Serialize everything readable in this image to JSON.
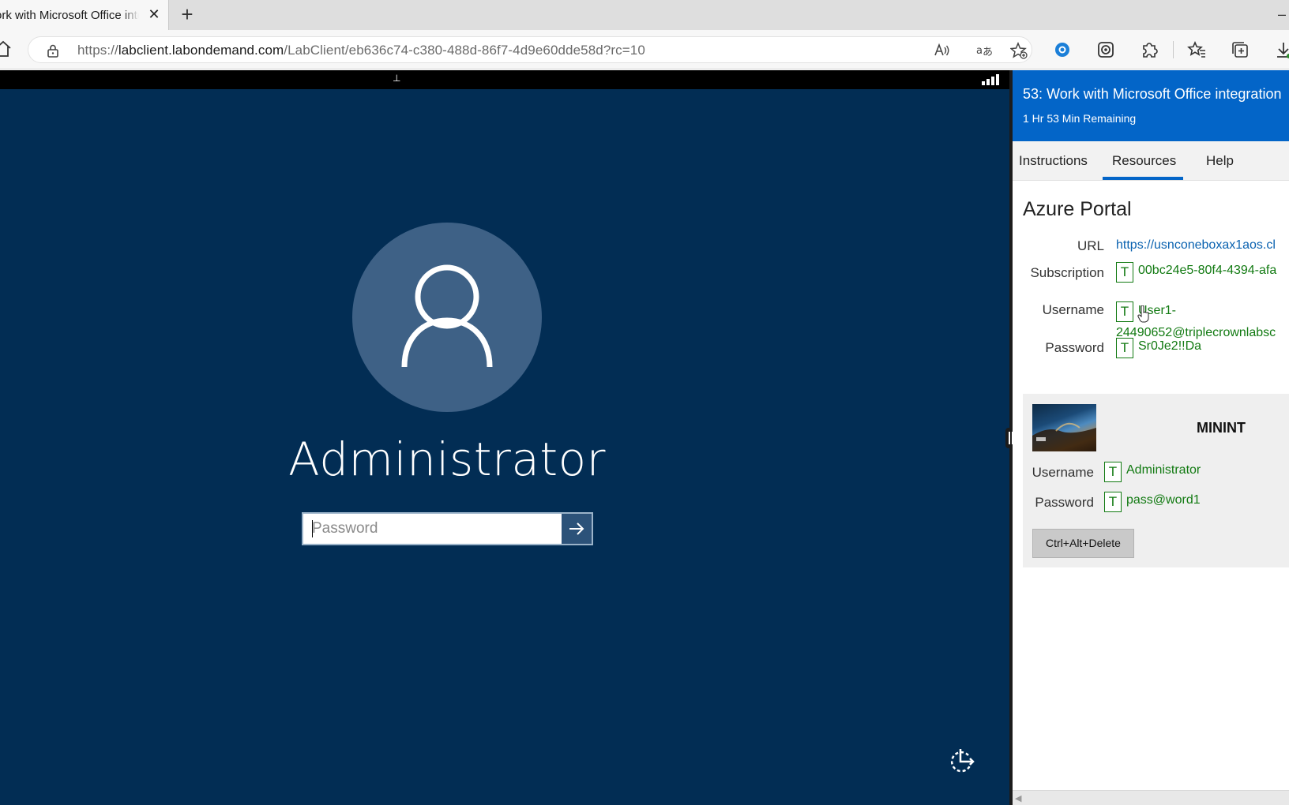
{
  "browser": {
    "tab_title": "ork with Microsoft Office integration",
    "tab_close_glyph": "✕",
    "new_tab_glyph": "+",
    "minimize_glyph": "–",
    "url_prefix": "https://",
    "url_host": "labclient.labondemand.com",
    "url_path": "/LabClient/eb636c74-c380-488d-86f7-4d9e60dde58d?rc=10",
    "toolbar_icons": [
      "home-icon",
      "lock-icon",
      "read-aloud-icon",
      "translate-icon",
      "add-favorite-icon",
      "copilot-icon",
      "collections-web-capture-icon",
      "extensions-icon",
      "favorites-icon",
      "collections-icon",
      "downloads-icon"
    ]
  },
  "vm": {
    "pin_glyph": "⊥",
    "lock_screen": {
      "user_name": "Administrator",
      "password_placeholder": "Password",
      "submit_glyph": "→"
    },
    "background_color": "#022d54",
    "avatar_color": "#3e6186"
  },
  "panel": {
    "header": {
      "title": "53: Work with Microsoft Office integration",
      "time_remaining": "1 Hr 53 Min Remaining",
      "color": "#0365c8"
    },
    "tabs": [
      {
        "label": "Instructions",
        "active": false
      },
      {
        "label": "Resources",
        "active": true
      },
      {
        "label": "Help",
        "active": false
      }
    ],
    "section_title": "Azure Portal",
    "type_button_label": "T",
    "azure": {
      "url_label": "URL",
      "url_value": "https://usnconeboxax1aos.cl",
      "subscription_label": "Subscription",
      "subscription_value": "00bc24e5-80f4-4394-afa",
      "username_label": "Username",
      "username_value_line1": "User1-",
      "username_value_line2": "24490652@triplecrownlabsc",
      "password_label": "Password",
      "password_value": "Sr0Je2!!Da"
    },
    "vm_card": {
      "name": "MININT",
      "username_label": "Username",
      "username_value": "Administrator",
      "password_label": "Password",
      "password_value": "pass@word1",
      "cad_button": "Ctrl+Alt+Delete"
    },
    "value_color": "#127a12",
    "link_color": "#0a62b0"
  }
}
